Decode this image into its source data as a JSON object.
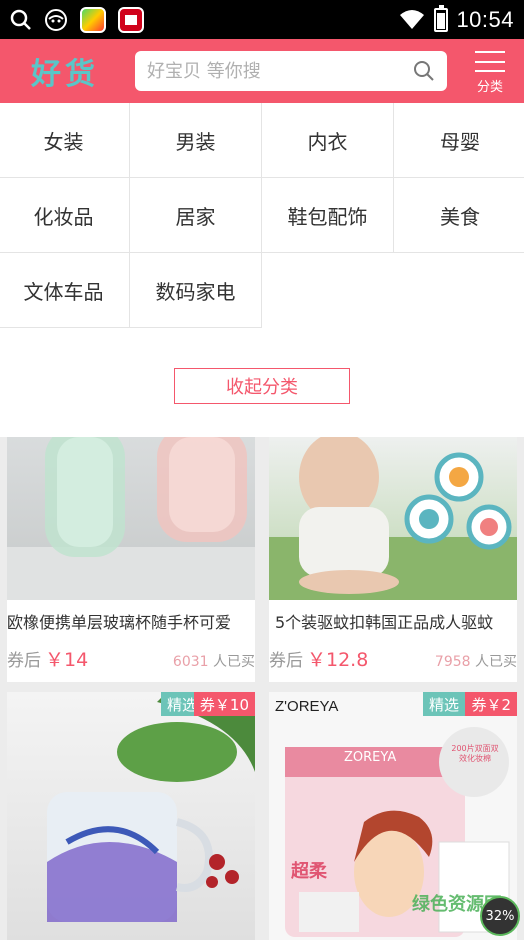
{
  "status_bar": {
    "time": "10:54"
  },
  "header": {
    "logo": "好货",
    "search_placeholder": "好宝贝 等你搜",
    "category_label": "分类"
  },
  "categories": [
    "女装",
    "男装",
    "内衣",
    "母婴",
    "化妆品",
    "居家",
    "鞋包配饰",
    "美食",
    "文体车品",
    "数码家电"
  ],
  "collapse_label": "收起分类",
  "products": [
    {
      "title": "欧橡便携单层玻璃杯随手杯可爱",
      "price_prefix": "券后",
      "price": "￥14",
      "sold_count": "6031",
      "sold_suffix": "人已买"
    },
    {
      "title": "5个装驱蚊扣韩国正品成人驱蚊",
      "price_prefix": "券后",
      "price": "￥12.8",
      "sold_count": "7958",
      "sold_suffix": "人已买"
    },
    {
      "badge_pick": "精选",
      "badge_coupon": "券￥10"
    },
    {
      "brand": "Z'OREYA",
      "badge_pick": "精选",
      "badge_coupon": "券￥2",
      "pack_brand": "ZOREYA",
      "pack_text": "超柔",
      "pack_circle": "200片双面双效化妆棉"
    }
  ],
  "overlay": {
    "watermark": "绿色资源网",
    "progress": "32%"
  },
  "colors": {
    "brand": "#f4576c",
    "logo": "#59c6c8",
    "badge_pick": "#6cc4b8"
  }
}
